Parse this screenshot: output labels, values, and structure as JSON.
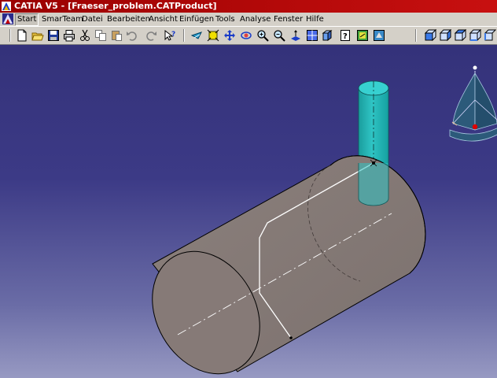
{
  "window": {
    "title": "CATIA V5 - [Fraeser_problem.CATProduct]"
  },
  "menu": {
    "items": [
      {
        "label": "Start",
        "active": true
      },
      {
        "label": "SmarTeam",
        "active": false
      },
      {
        "label": "Datei",
        "active": false
      },
      {
        "label": "Bearbeiten",
        "active": false
      },
      {
        "label": "Ansicht",
        "active": false
      },
      {
        "label": "Einfügen",
        "active": false
      },
      {
        "label": "Tools",
        "active": false
      },
      {
        "label": "Analyse",
        "active": false
      },
      {
        "label": "Fenster",
        "active": false
      },
      {
        "label": "Hilfe",
        "active": false
      }
    ]
  },
  "toolbar": {
    "buttons": [
      "new-icon",
      "open-icon",
      "save-icon",
      "print-icon",
      "cut-icon",
      "copy-icon",
      "paste-icon",
      "undo-icon",
      "redo-icon",
      "whats-this-icon",
      "fly-mode-icon",
      "fit-all-icon",
      "pan-icon",
      "rotate-icon",
      "zoom-in-icon",
      "zoom-out-icon",
      "normal-view-icon",
      "multi-view-icon",
      "iso-view-icon",
      "hide-show-icon",
      "swap-visible-icon",
      "render-style-icon",
      "view-front-icon",
      "view-back-icon",
      "view-left-icon",
      "view-right-icon",
      "view-top-icon"
    ]
  },
  "colors": {
    "title_bar": "#b00000",
    "viewport_top": "#34327a",
    "viewport_bottom": "#9799c2",
    "cylinder_fill": "#857a77",
    "cutter_fill": "#22b5b5",
    "compass_fill": "#2c5a7a",
    "compass_point": "#e00000"
  }
}
